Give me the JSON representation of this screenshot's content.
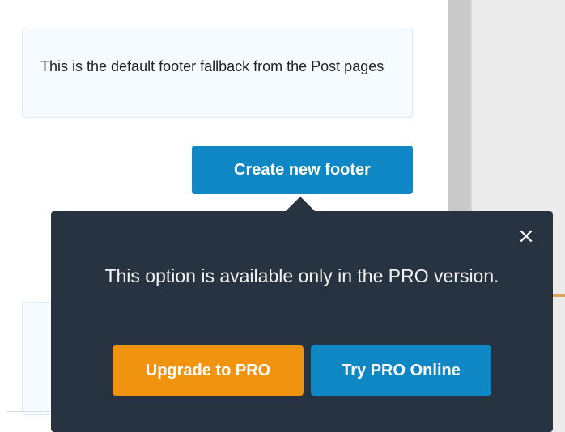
{
  "footer_panel": {
    "fallback_text": "This is the default footer fallback from the Post pages",
    "create_button_label": "Create new footer"
  },
  "pro_popover": {
    "close_icon": "×",
    "message": "This option is available only in the PRO version.",
    "upgrade_label": "Upgrade to PRO",
    "try_label": "Try PRO Online"
  },
  "colors": {
    "primary": "#0f87c5",
    "upgrade": "#f0930f",
    "popover_bg": "#273340"
  }
}
